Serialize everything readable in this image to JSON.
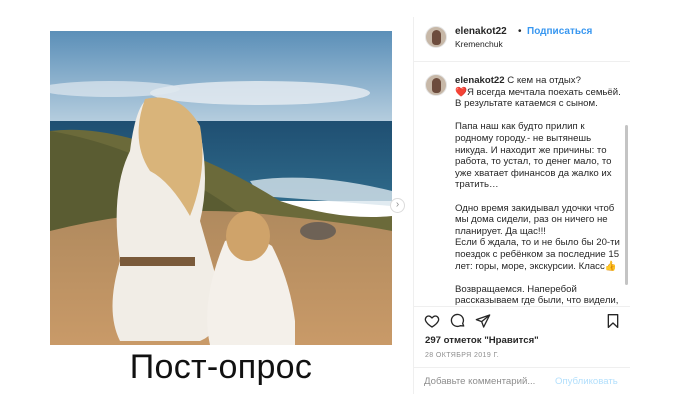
{
  "post": {
    "photo_caption": "Пост-опрос"
  },
  "header": {
    "username": "elenakot22",
    "dot": "•",
    "follow_label": "Подписаться",
    "location": "Kremenchuk"
  },
  "comment": {
    "username": "elenakot22",
    "lines": [
      "С кем на отдых?",
      "❤️Я всегда мечтала поехать семьёй.",
      "В результате катаемся с сыном.",
      "",
      "Папа наш как будто прилип к",
      "родному городу.- не вытянешь",
      "никуда. И находит же причины: то",
      "работа, то устал, то денег мало, то",
      "уже хватает финансов да жалко их",
      "тратить…",
      "",
      "Одно время закидывал удочки чтоб",
      "мы дома сидели, раз он ничего не",
      "планирует. Да щас!!!",
      "Если б ждала, то и не было бы 20-ти",
      "поездок с ребёнком за последние 15",
      "лет: горы, море, экскурсии. Класс👍",
      "",
      "Возвращаемся. Наперебой",
      "рассказываем где были, что видели,"
    ]
  },
  "actions": {
    "likes_text": "297 отметок \"Нравится\"",
    "date": "28 ОКТЯБРЯ 2019 Г."
  },
  "add_comment": {
    "placeholder": "Добавьте комментарий...",
    "publish_label": "Опубликовать"
  },
  "colors": {
    "link_blue": "#3897f0",
    "publish_disabled": "#b2dffc",
    "muted": "#8e8e8e",
    "heart": "#ed4956"
  },
  "icons": [
    "heart-icon",
    "comment-icon",
    "share-icon",
    "bookmark-icon",
    "chevron-right-icon"
  ]
}
